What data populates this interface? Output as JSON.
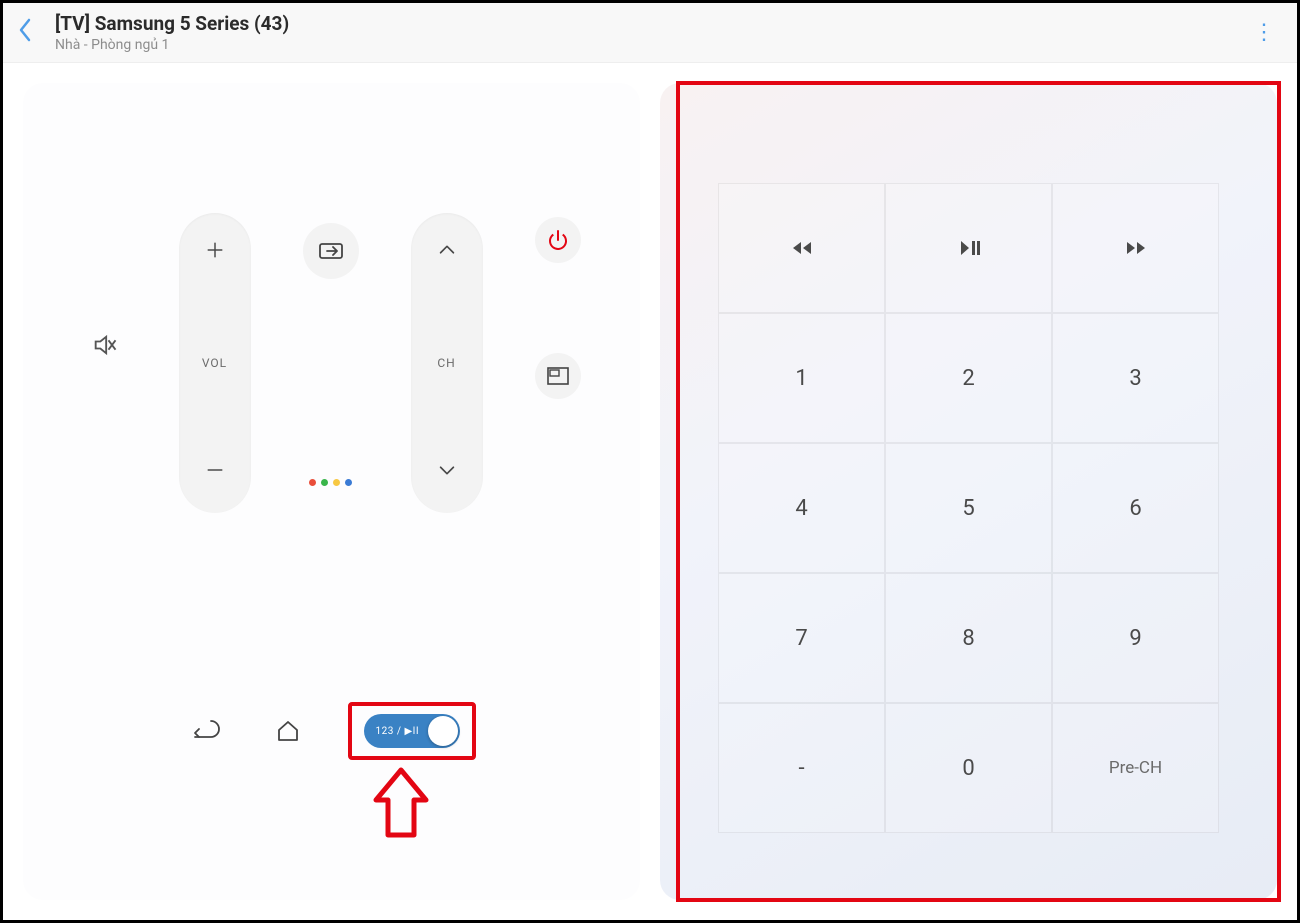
{
  "header": {
    "title": "[TV] Samsung 5 Series (43)",
    "subtitle": "Nhà - Phòng ngủ 1"
  },
  "remote": {
    "vol_label": "VOL",
    "ch_label": "CH",
    "toggle_label": "123 / ▶II"
  },
  "keypad": {
    "rows": [
      [
        "◀◀",
        "▶II",
        "▶▶"
      ],
      [
        "1",
        "2",
        "3"
      ],
      [
        "4",
        "5",
        "6"
      ],
      [
        "7",
        "8",
        "9"
      ],
      [
        "-",
        "0",
        "Pre-CH"
      ]
    ]
  }
}
